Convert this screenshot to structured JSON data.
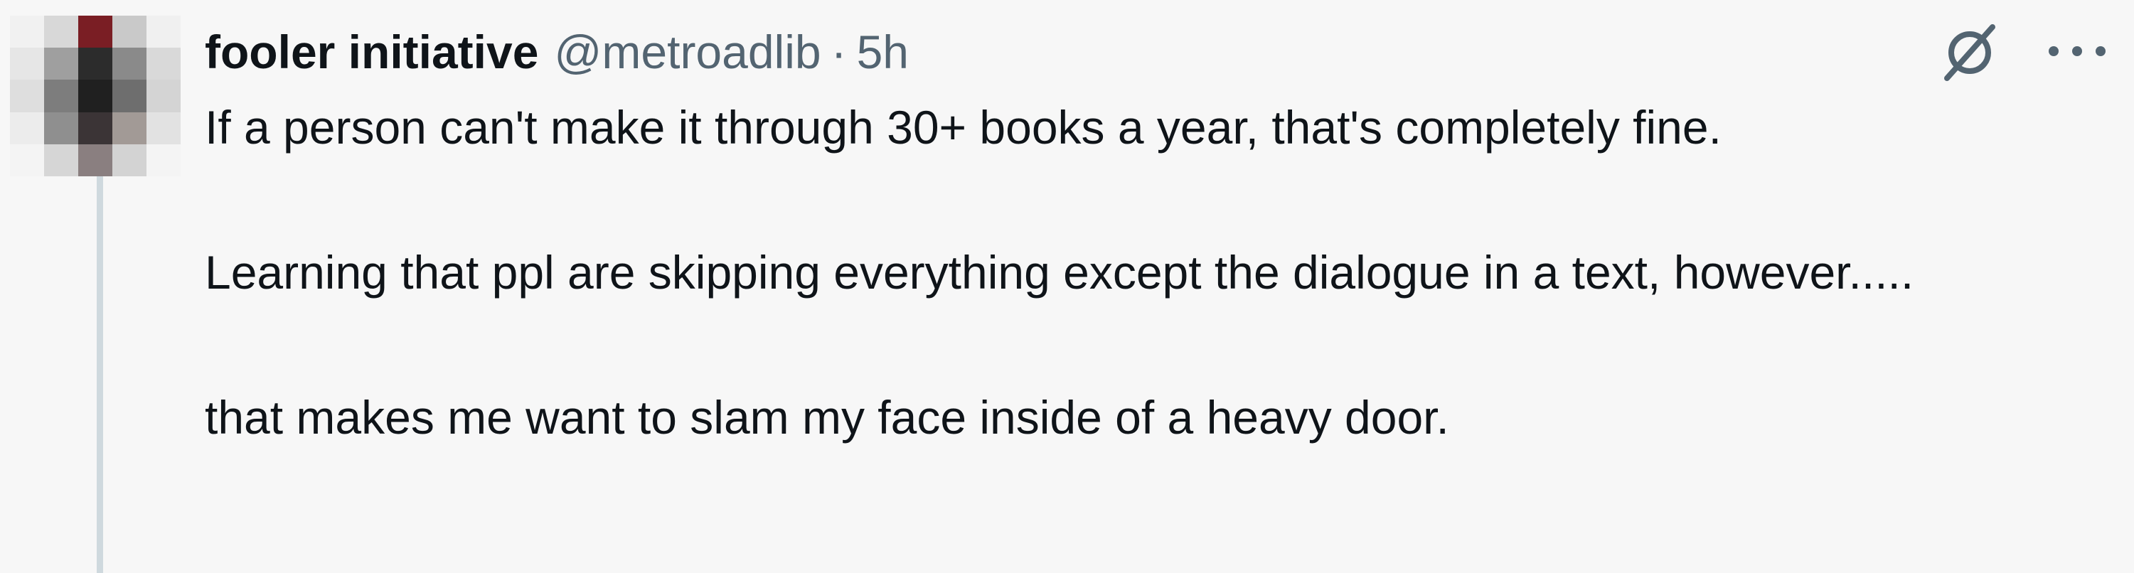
{
  "tweet": {
    "display_name": "fooler initiative",
    "handle": "@metroadlib",
    "separator": "·",
    "time": "5h",
    "paragraphs": [
      "If a person can't make it through 30+ books a year, that's completely fine.",
      "Learning that ppl are skipping everything except the dialogue in a text, however.....",
      "that makes me want to slam my face inside of a heavy door."
    ]
  },
  "icons": {
    "grok": "grok-icon",
    "more": "more-options-icon",
    "avatar": "avatar-image"
  },
  "colors": {
    "background": "#f7f7f7",
    "text": "#0f1419",
    "secondary_text": "#536471",
    "thread_line": "#cfd9de"
  }
}
